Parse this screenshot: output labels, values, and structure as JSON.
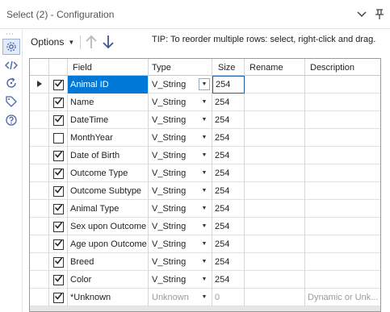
{
  "window": {
    "title": "Select (2) - Configuration"
  },
  "toolbar": {
    "options_label": "Options",
    "tip": "TIP: To reorder multiple rows: select, right-click and drag."
  },
  "sidebar": {
    "icons": [
      "gear-icon",
      "code-icon",
      "refresh-icon",
      "tag-icon",
      "help-icon"
    ]
  },
  "grid": {
    "headers": {
      "field": "Field",
      "type": "Type",
      "size": "Size",
      "rename": "Rename",
      "description": "Description"
    },
    "rows": [
      {
        "checked": true,
        "field": "Animal ID",
        "type": "V_String",
        "size": "254",
        "rename": "",
        "description": "",
        "selected": true
      },
      {
        "checked": true,
        "field": "Name",
        "type": "V_String",
        "size": "254",
        "rename": "",
        "description": ""
      },
      {
        "checked": true,
        "field": "DateTime",
        "type": "V_String",
        "size": "254",
        "rename": "",
        "description": ""
      },
      {
        "checked": false,
        "field": "MonthYear",
        "type": "V_String",
        "size": "254",
        "rename": "",
        "description": ""
      },
      {
        "checked": true,
        "field": "Date of Birth",
        "type": "V_String",
        "size": "254",
        "rename": "",
        "description": ""
      },
      {
        "checked": true,
        "field": "Outcome Type",
        "type": "V_String",
        "size": "254",
        "rename": "",
        "description": ""
      },
      {
        "checked": true,
        "field": "Outcome Subtype",
        "type": "V_String",
        "size": "254",
        "rename": "",
        "description": ""
      },
      {
        "checked": true,
        "field": "Animal Type",
        "type": "V_String",
        "size": "254",
        "rename": "",
        "description": ""
      },
      {
        "checked": true,
        "field": "Sex upon Outcome",
        "type": "V_String",
        "size": "254",
        "rename": "",
        "description": ""
      },
      {
        "checked": true,
        "field": "Age upon Outcome",
        "type": "V_String",
        "size": "254",
        "rename": "",
        "description": ""
      },
      {
        "checked": true,
        "field": "Breed",
        "type": "V_String",
        "size": "254",
        "rename": "",
        "description": ""
      },
      {
        "checked": true,
        "field": "Color",
        "type": "V_String",
        "size": "254",
        "rename": "",
        "description": ""
      },
      {
        "checked": true,
        "field": "*Unknown",
        "type": "Unknown",
        "size": "0",
        "rename": "",
        "description": "Dynamic or Unk...",
        "dim": true
      }
    ]
  },
  "colors": {
    "selection": "#0078d7",
    "icon_blue": "#4a63a8"
  }
}
